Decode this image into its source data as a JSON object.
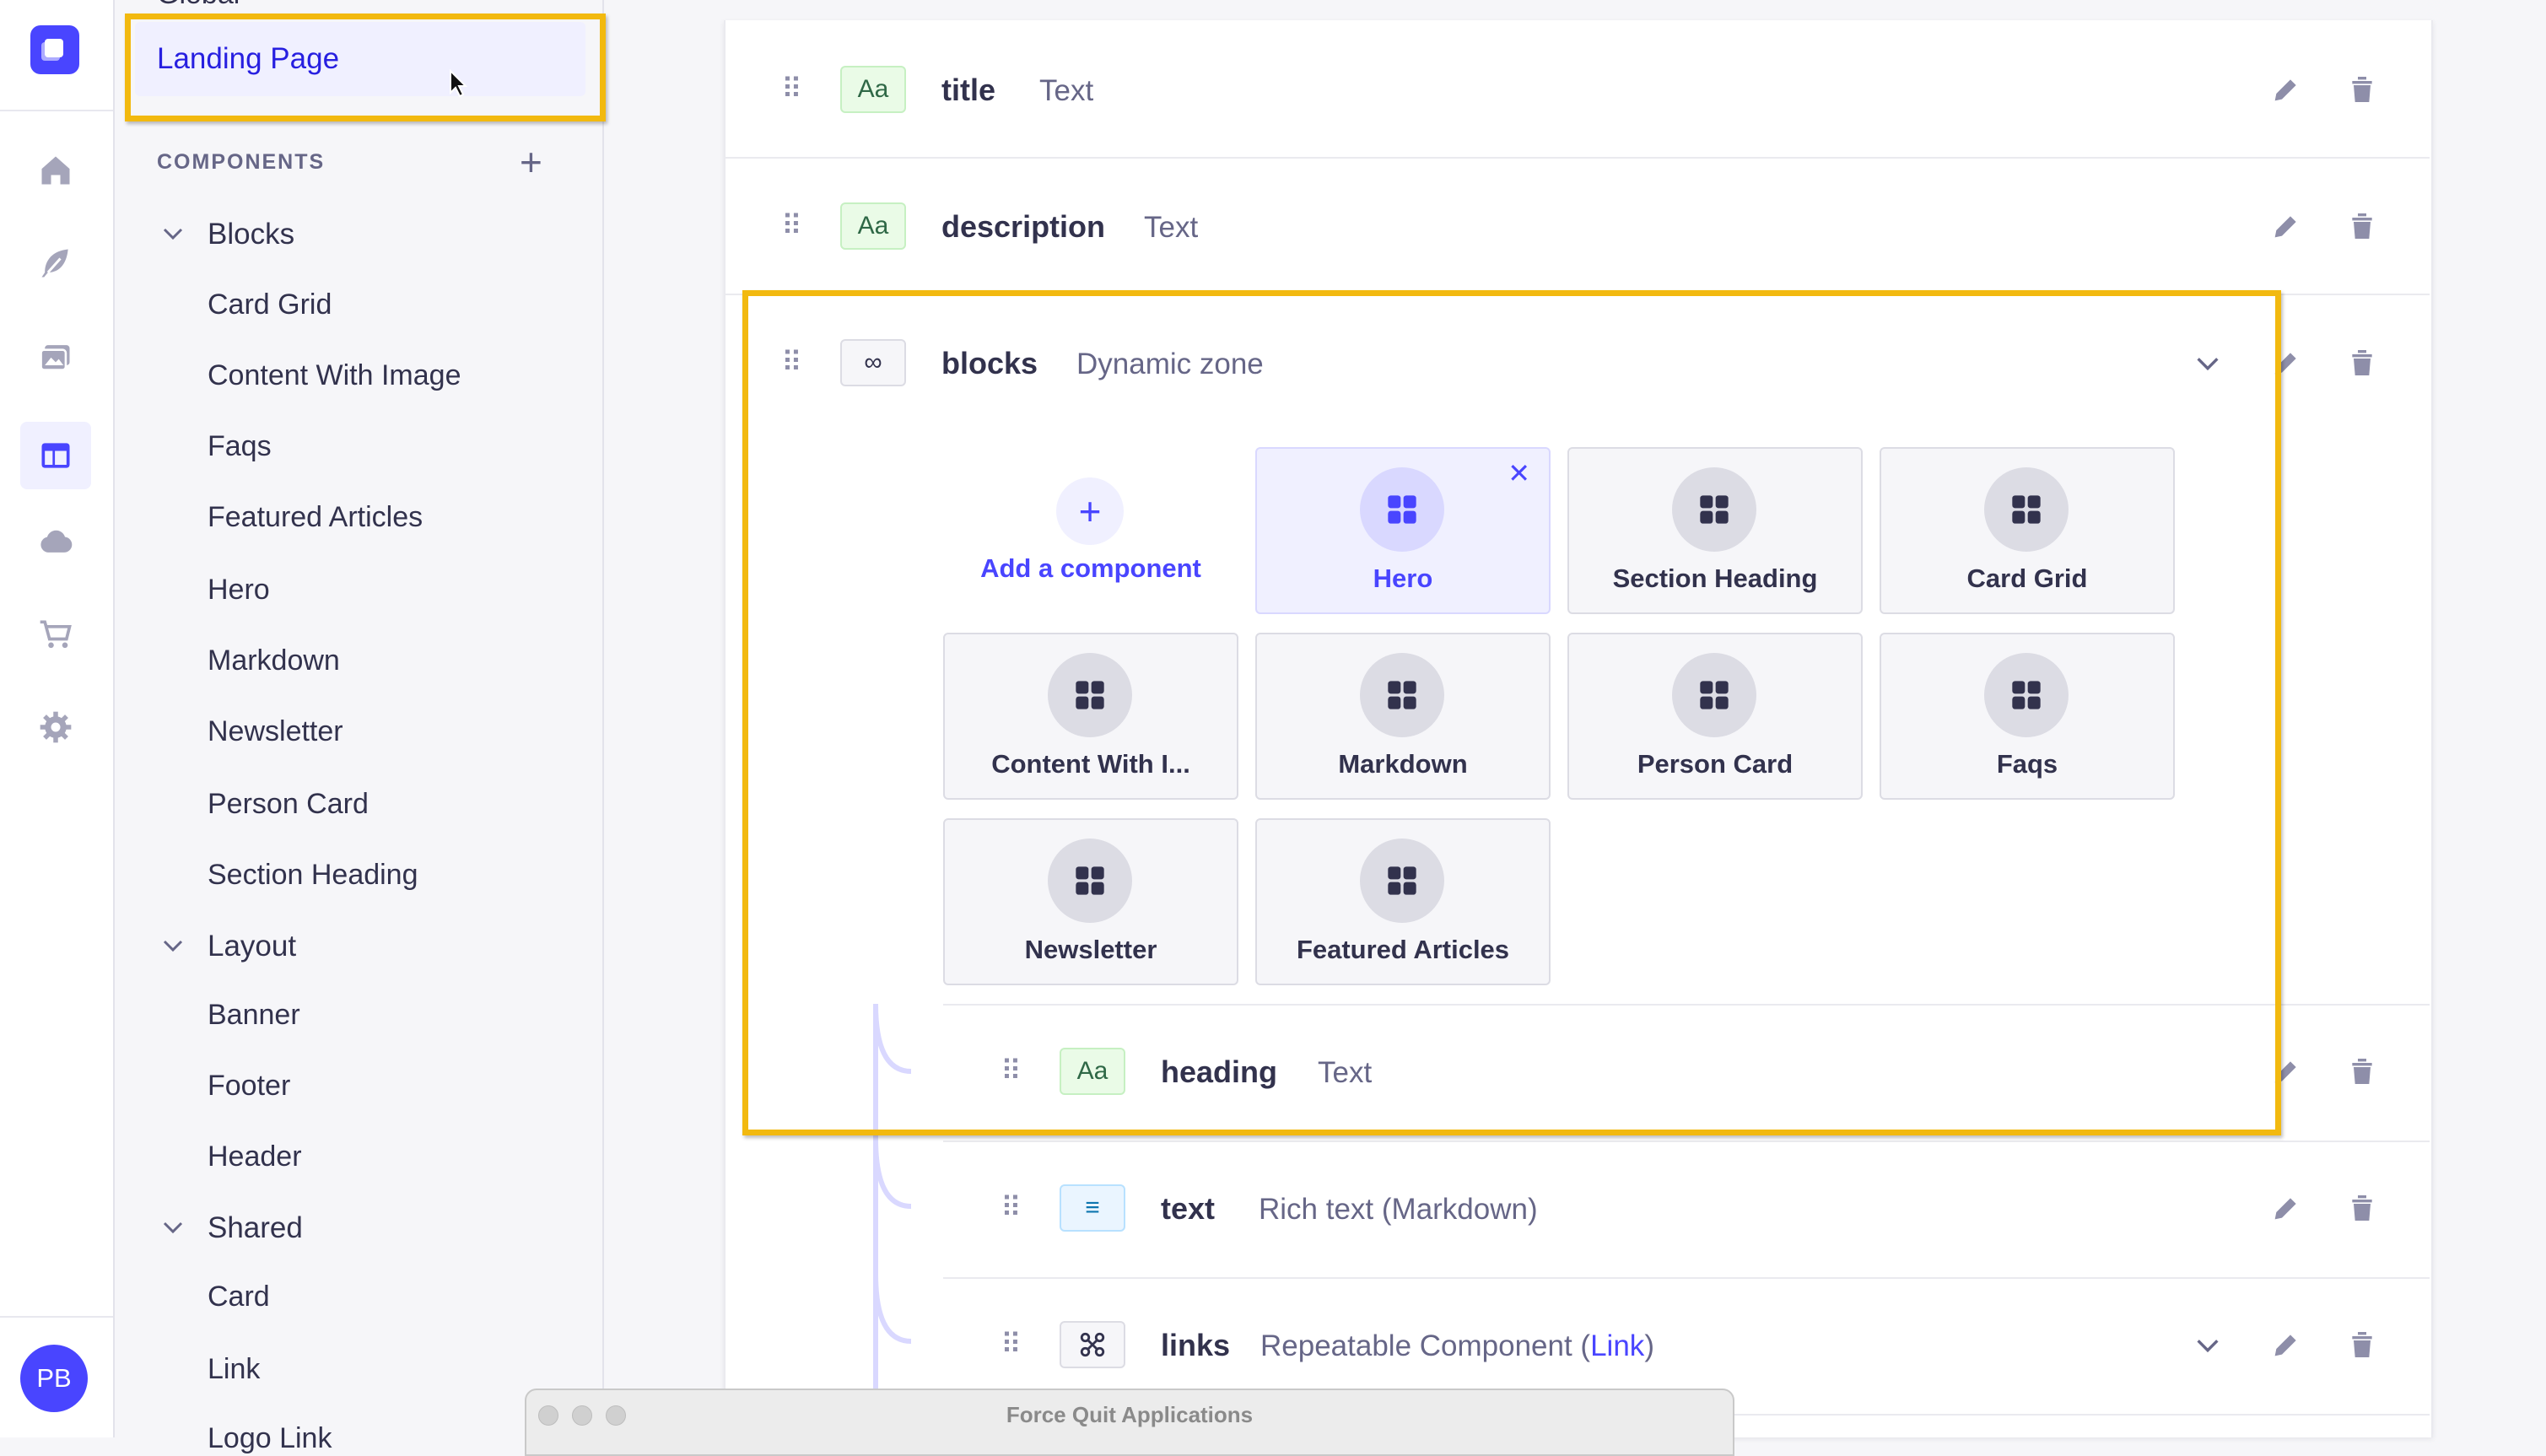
{
  "sidebar_top_cut": "Global",
  "subnav": {
    "active_item": "Landing Page",
    "components_title": "COMPONENTS",
    "groups": [
      {
        "label": "Blocks",
        "items": [
          "Card Grid",
          "Content With Image",
          "Faqs",
          "Featured Articles",
          "Hero",
          "Markdown",
          "Newsletter",
          "Person Card",
          "Section Heading"
        ]
      },
      {
        "label": "Layout",
        "items": [
          "Banner",
          "Footer",
          "Header"
        ]
      },
      {
        "label": "Shared",
        "items": [
          "Card",
          "Link",
          "Logo Link"
        ]
      }
    ]
  },
  "rail": {
    "icons": [
      "home-icon",
      "feather-icon",
      "media-library-icon",
      "layout-icon",
      "cloud-icon",
      "cart-icon",
      "settings-icon"
    ],
    "avatar_initials": "PB"
  },
  "fields": [
    {
      "name": "title",
      "type": "Text",
      "badge": "Aa"
    },
    {
      "name": "description",
      "type": "Text",
      "badge": "Aa"
    },
    {
      "name": "blocks",
      "type": "Dynamic zone",
      "badge": "∞"
    }
  ],
  "dynamic_zone": {
    "add_label": "Add a component",
    "components": [
      "Hero",
      "Section Heading",
      "Card Grid",
      "Content With I...",
      "Markdown",
      "Person Card",
      "Faqs",
      "Newsletter",
      "Featured Articles"
    ]
  },
  "sub_fields": [
    {
      "name": "heading",
      "type": "Text",
      "badge": "Aa"
    },
    {
      "name": "text",
      "type": "Rich text (Markdown)",
      "badge": "≡"
    },
    {
      "name": "links",
      "type_prefix": "Repeatable Component (",
      "type_link": "Link",
      "type_suffix": ")"
    }
  ],
  "overlay_window": {
    "title": "Force Quit Applications"
  },
  "colors": {
    "accent": "#4945ff",
    "highlight": "#f2b90f"
  }
}
